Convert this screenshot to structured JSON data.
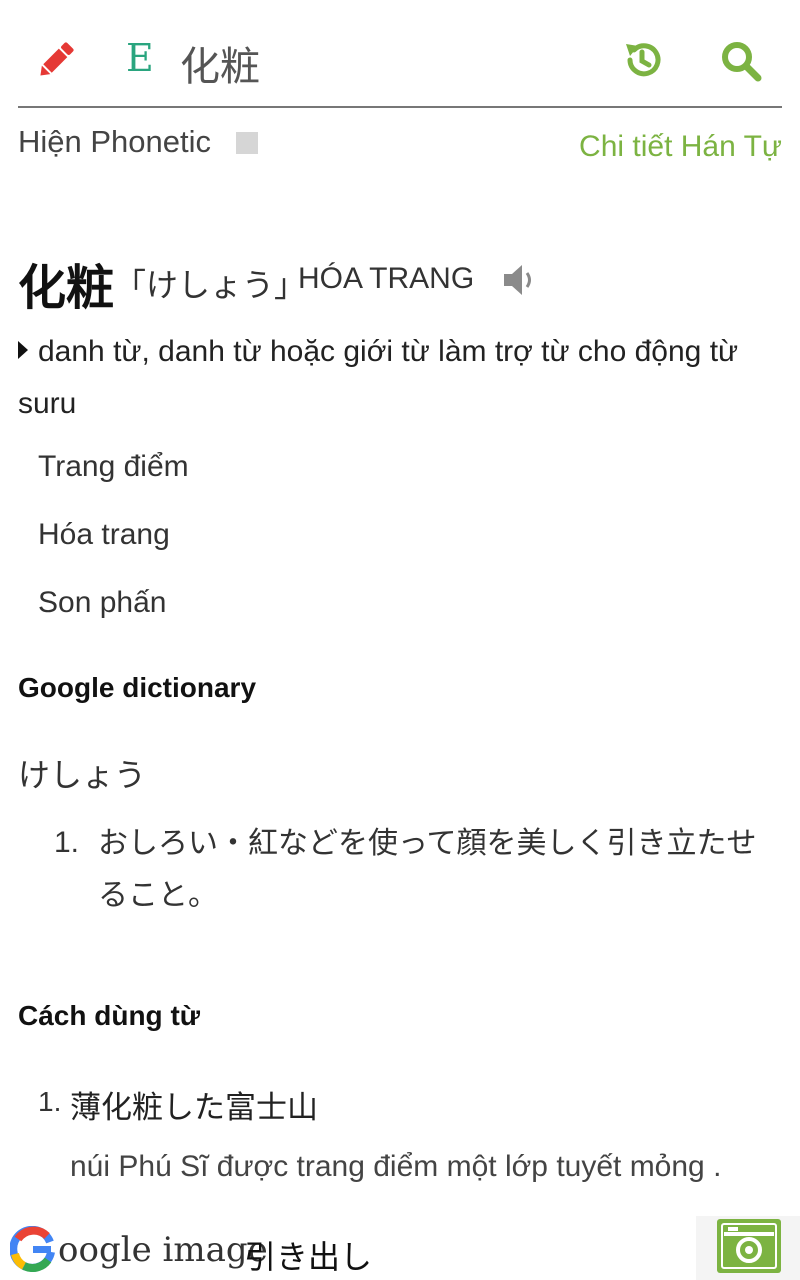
{
  "colors": {
    "accent_green": "#7cb342",
    "lang_badge": "#2aa57f",
    "edit_red": "#e53935",
    "divider": "#777777"
  },
  "header": {
    "edit_icon": "pencil-icon",
    "lang_badge": "E",
    "word": "化粧",
    "history_icon": "history-icon",
    "search_icon": "search-icon"
  },
  "options": {
    "phonetic_label": "Hiện Phonetic",
    "phonetic_checked": false,
    "han_tu_link": "Chi tiết Hán Tự"
  },
  "entry": {
    "word": "化粧",
    "reading": "「けしょう」",
    "hanviet": "HÓA TRANG",
    "speaker_icon": "speaker-icon",
    "part_of_speech": "danh từ, danh từ hoặc giới từ làm trợ từ cho động từ suru",
    "meanings": [
      "Trang điểm",
      "Hóa trang",
      "Son phấn"
    ]
  },
  "google_dictionary": {
    "title": "Google dictionary",
    "reading": "けしょう",
    "definitions": [
      {
        "num": "1.",
        "text": "おしろい・紅などを使って顔を美しく引き立たせること。"
      }
    ]
  },
  "usage": {
    "title": "Cách dùng từ",
    "examples": [
      {
        "num": "1.",
        "jp": "薄化粧した富士山",
        "vi": "núi Phú Sĩ được trang điểm một lớp tuyết mỏng ."
      }
    ]
  },
  "bottom_bar": {
    "google_image_label": "oogle image",
    "hikidashi_label": "引き出し",
    "camera_icon": "camera-icon"
  }
}
